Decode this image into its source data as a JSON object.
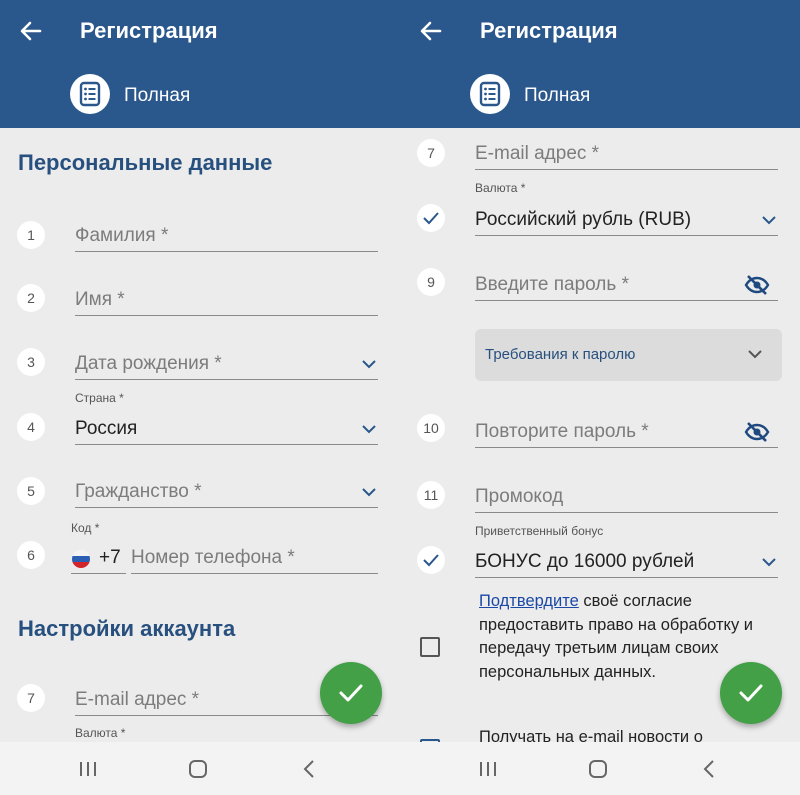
{
  "left": {
    "header": {
      "title": "Регистрация",
      "mode_label": "Полная"
    },
    "section_personal": "Персональные данные",
    "fields": [
      {
        "num": "1",
        "placeholder": "Фамилия *"
      },
      {
        "num": "2",
        "placeholder": "Имя *"
      },
      {
        "num": "3",
        "placeholder": "Дата рождения *"
      },
      {
        "num": "4",
        "label": "Страна *",
        "value": "Россия"
      },
      {
        "num": "5",
        "placeholder": "Гражданство *"
      },
      {
        "num": "6",
        "label": "Код *",
        "code": "+7",
        "placeholder": "Номер телефона *"
      }
    ],
    "section_account": "Настройки аккаунта",
    "email": {
      "num": "7",
      "placeholder": "E-mail адрес *"
    },
    "currency_label": "Валюта *"
  },
  "right": {
    "header": {
      "title": "Регистрация",
      "mode_label": "Полная"
    },
    "email": {
      "num": "7",
      "placeholder": "E-mail адрес *"
    },
    "currency": {
      "label": "Валюта *",
      "value": "Российский рубль (RUB)"
    },
    "password": {
      "num": "9",
      "placeholder": "Введите пароль *"
    },
    "password_requirements": "Требования к паролю",
    "repeat_password": {
      "num": "10",
      "placeholder": "Повторите пароль *"
    },
    "promo": {
      "num": "11",
      "placeholder": "Промокод"
    },
    "bonus": {
      "label": "Приветственный бонус",
      "value": "БОНУС до 16000 рублей"
    },
    "consent": {
      "link": "Подтвердите",
      "line1_rest": " своё согласие",
      "line2": "предоставить право на обработку и",
      "line3": "передачу третьим лицам своих",
      "line4": "персональных данных."
    },
    "news_partial": "Получать на e-mail новости о"
  },
  "colors": {
    "appbar": "#2a578c",
    "section_title": "#28507f",
    "fab": "#43a047",
    "link": "#1a48a6",
    "background": "#ececec"
  },
  "icons": [
    "back-arrow-icon",
    "list-icon",
    "chevron-down-icon",
    "eye-off-icon",
    "check-icon",
    "recents-icon",
    "home-icon",
    "nav-back-icon"
  ]
}
